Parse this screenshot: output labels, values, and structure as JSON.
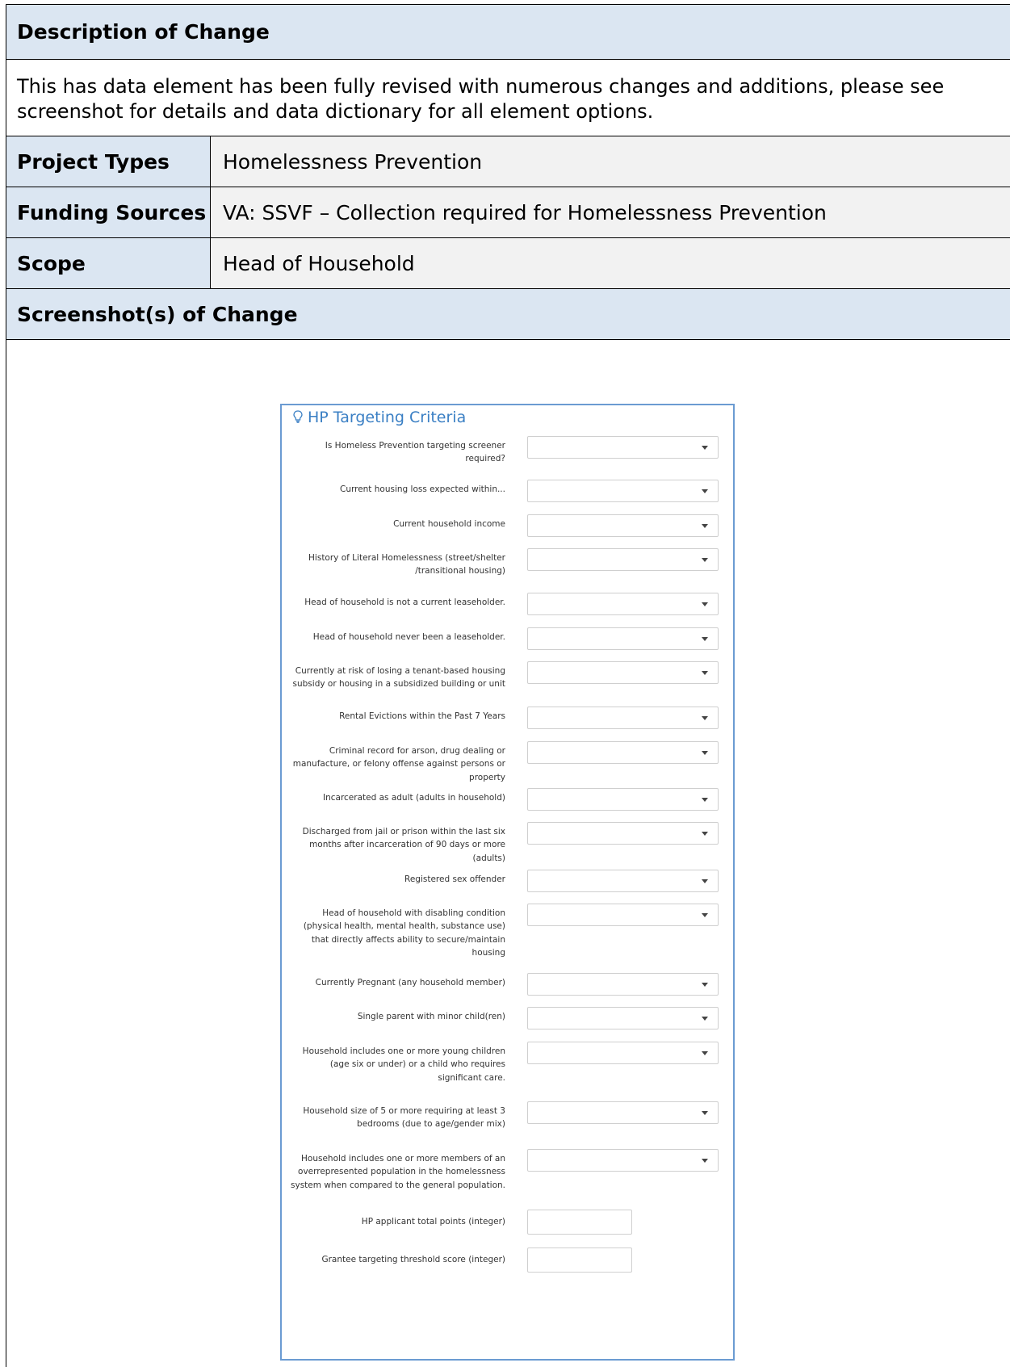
{
  "sections": {
    "description_header": "Description of Change",
    "description_text": "This has data element has been fully revised with numerous changes and additions, please see screenshot for details and data dictionary for all element options.",
    "screenshot_header": "Screenshot(s) of Change"
  },
  "details": [
    {
      "key": "Project Types",
      "value": "Homelessness Prevention"
    },
    {
      "key": "Funding Sources",
      "value": "VA: SSVF – Collection required for Homelessness Prevention"
    },
    {
      "key": "Scope",
      "value": "Head of Household"
    }
  ],
  "form": {
    "title": "HP Targeting Criteria",
    "title_icon": "lightbulb-icon",
    "accent_color": "#3a7fc4",
    "fields": [
      {
        "label": "Is Homeless Prevention targeting screener required?",
        "type": "select"
      },
      {
        "label": "Current housing loss expected within...",
        "type": "select"
      },
      {
        "label": "Current household income",
        "type": "select"
      },
      {
        "label": "History of Literal Homelessness (street/shelter /transitional housing)",
        "type": "select"
      },
      {
        "label": "Head of household is not a current leaseholder.",
        "type": "select"
      },
      {
        "label": "Head of household never been a leaseholder.",
        "type": "select"
      },
      {
        "label": "Currently at risk of losing a tenant-based housing subsidy or housing in a subsidized building or unit",
        "type": "select"
      },
      {
        "label": "Rental Evictions within the Past 7 Years",
        "type": "select"
      },
      {
        "label": "Criminal record for arson, drug dealing or manufacture, or felony offense against persons or property",
        "type": "select"
      },
      {
        "label": "Incarcerated as adult (adults in household)",
        "type": "select"
      },
      {
        "label": "Discharged from jail or prison within the last six months after incarceration of 90 days or more (adults)",
        "type": "select"
      },
      {
        "label": "Registered sex offender",
        "type": "select"
      },
      {
        "label": "Head of household with disabling condition (physical health, mental health, substance use) that directly affects ability to secure/maintain housing",
        "type": "select"
      },
      {
        "label": "Currently Pregnant (any household member)",
        "type": "select"
      },
      {
        "label": "Single parent with minor child(ren)",
        "type": "select"
      },
      {
        "label": "Household includes one or more young children (age six or under) or a child who requires significant care.",
        "type": "select"
      },
      {
        "label": "Household size of 5 or more requiring at least 3 bedrooms (due to age/gender mix)",
        "type": "select"
      },
      {
        "label": "Household includes one or more members of an overrepresented population in the homelessness system when compared to the general population.",
        "type": "select"
      },
      {
        "label": "HP applicant total points (integer)",
        "type": "number"
      },
      {
        "label": "Grantee targeting threshold score (integer)",
        "type": "number"
      }
    ]
  }
}
